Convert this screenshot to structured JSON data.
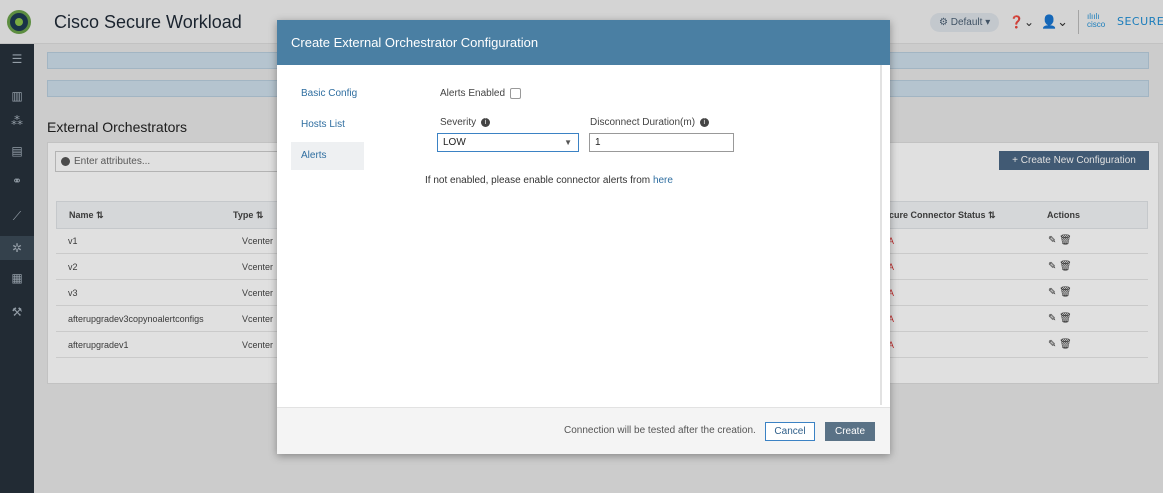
{
  "header": {
    "app_title": "Cisco Secure Workload",
    "scope_label": "⚙ Default ▾",
    "help_icon": "question-icon",
    "user_icon": "user-icon",
    "cisco_logo": "cisco",
    "brand_text": "SECURE"
  },
  "leftnav": {
    "items": [
      {
        "icon": "menu-icon",
        "glyph": "☰"
      },
      {
        "icon": "dashboard-icon",
        "glyph": "▥"
      },
      {
        "icon": "org-icon",
        "glyph": "⁂"
      },
      {
        "icon": "inventory-icon",
        "glyph": "▤"
      },
      {
        "icon": "binoculars-icon",
        "glyph": "⚭"
      },
      {
        "icon": "chart-icon",
        "glyph": "⟋"
      },
      {
        "icon": "settings-icon",
        "glyph": "✲"
      },
      {
        "icon": "platform-icon",
        "glyph": "▦"
      },
      {
        "icon": "tools-icon",
        "glyph": "⚒"
      }
    ]
  },
  "page": {
    "title": "External Orchestrators",
    "filter_placeholder": "Enter attributes...",
    "create_button": "+ Create New Configuration"
  },
  "table": {
    "headers": {
      "name": "Name ⇅",
      "type": "Type ⇅",
      "status": "cure Connector Status ⇅",
      "actions": "Actions"
    },
    "rows": [
      {
        "name": "v1",
        "type": "Vcenter",
        "status": "A"
      },
      {
        "name": "v2",
        "type": "Vcenter",
        "status": "A"
      },
      {
        "name": "v3",
        "type": "Vcenter",
        "status": "A"
      },
      {
        "name": "afterupgradev3copynoalertconfigs",
        "type": "Vcenter",
        "status": "A"
      },
      {
        "name": "afterupgradev1",
        "type": "Vcenter",
        "status": "A"
      }
    ]
  },
  "modal": {
    "title": "Create External Orchestrator Configuration",
    "nav": [
      "Basic Config",
      "Hosts List",
      "Alerts"
    ],
    "active_nav": "Alerts",
    "alerts_enabled_label": "Alerts Enabled",
    "alerts_enabled": false,
    "severity_label": "Severity",
    "severity_value": "LOW",
    "disconnect_label": "Disconnect Duration(m)",
    "disconnect_value": "1",
    "hint_text": "If not enabled, please enable connector alerts from",
    "hint_link": "here",
    "footer_note": "Connection will be tested after the creation.",
    "cancel_label": "Cancel",
    "create_label": "Create"
  }
}
